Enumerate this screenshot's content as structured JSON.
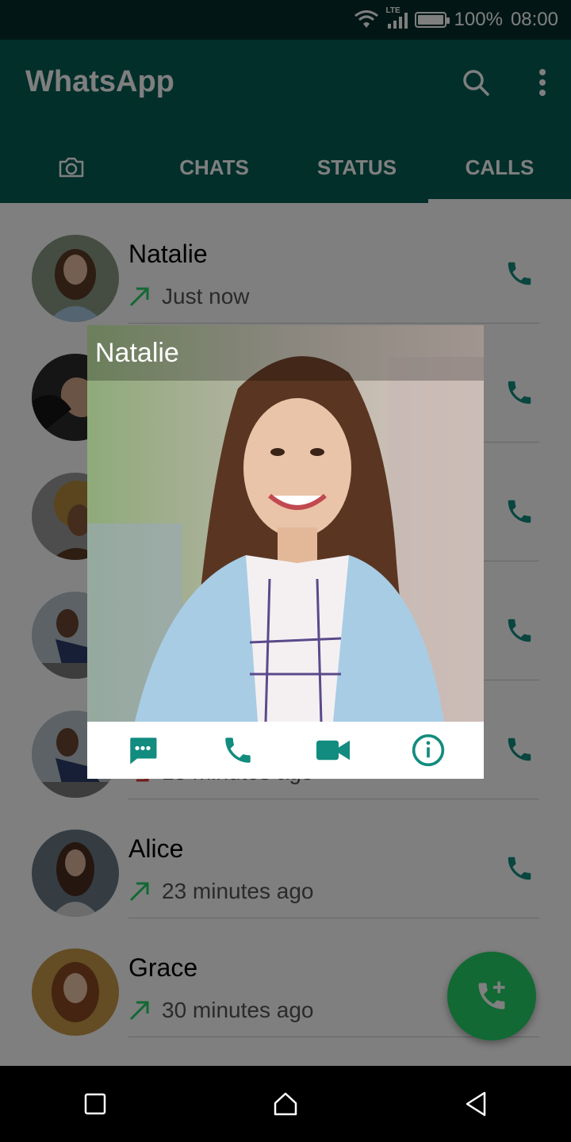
{
  "status_bar": {
    "network": "LTE",
    "battery": "100%",
    "battery_level": 1.0,
    "time": "08:00",
    "icons": [
      "wifi-icon",
      "signal-icon",
      "battery-icon"
    ]
  },
  "app": {
    "title": "WhatsApp",
    "actions": [
      "search-icon",
      "more-vert-icon"
    ]
  },
  "tabs": [
    {
      "label": "",
      "icon": "camera-icon"
    },
    {
      "label": "CHATS"
    },
    {
      "label": "STATUS"
    },
    {
      "label": "CALLS",
      "active": true
    }
  ],
  "calls": [
    {
      "name": "Natalie",
      "time": "Just now",
      "direction": "outgoing"
    },
    {
      "name": "",
      "time": "",
      "direction": "outgoing"
    },
    {
      "name": "",
      "time": "",
      "direction": "outgoing"
    },
    {
      "name": "",
      "time": "",
      "direction": "outgoing"
    },
    {
      "name": "",
      "time": "15 minutes ago",
      "direction": "missed"
    },
    {
      "name": "Alice",
      "time": "23 minutes ago",
      "direction": "outgoing"
    },
    {
      "name": "Grace",
      "time": "30 minutes ago",
      "direction": "outgoing"
    }
  ],
  "popup": {
    "name": "Natalie",
    "actions": [
      "message-icon",
      "phone-icon",
      "videocam-icon",
      "info-icon"
    ]
  },
  "fab": {
    "icon": "add-call-icon"
  },
  "nav": [
    "recents-icon",
    "home-icon",
    "back-icon"
  ],
  "colors": {
    "primary": "#075e54",
    "status_bar": "#042f2a",
    "accent": "#25d366",
    "icon_teal": "#128c7e"
  }
}
